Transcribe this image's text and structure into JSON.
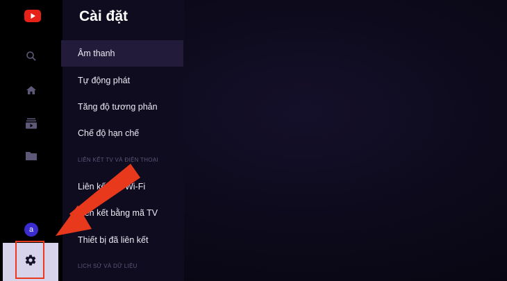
{
  "app": {
    "logo_icon": "youtube-logo-icon",
    "accent_color": "#e8391d"
  },
  "rail": {
    "icons": [
      "search-icon",
      "home-icon",
      "subscriptions-icon",
      "library-icon"
    ],
    "avatar_letter": "a",
    "settings_icon": "gear-icon"
  },
  "settings": {
    "title": "Cài đặt",
    "items": [
      {
        "label": "Âm thanh"
      },
      {
        "label": "Tự động phát"
      },
      {
        "label": "Tăng độ tương phản"
      },
      {
        "label": "Chế độ hạn chế"
      }
    ],
    "section_link": "LIÊN KẾT TV VÀ ĐIỆN THOẠI",
    "link_items": [
      {
        "label": "Liên kết với Wi-Fi"
      },
      {
        "label": "Liên kết bằng mã TV"
      },
      {
        "label": "Thiết bị đã liên kết"
      }
    ],
    "section_history": "LỊCH SỬ VÀ DỮ LIỆU"
  }
}
